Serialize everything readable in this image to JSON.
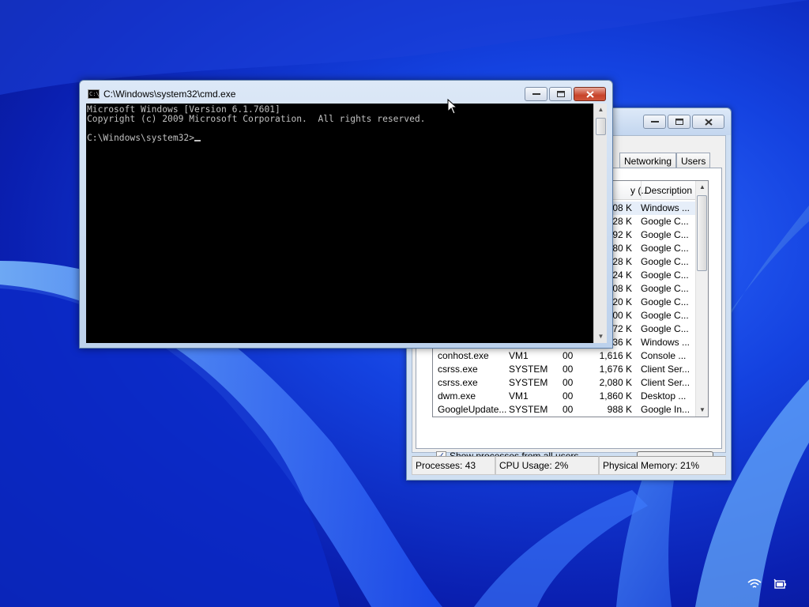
{
  "cmd": {
    "title": "C:\\Windows\\system32\\cmd.exe",
    "icon": "cmd-app-icon",
    "icon_text": "C:\\",
    "lines": [
      "Microsoft Windows [Version 6.1.7601]",
      "Copyright (c) 2009 Microsoft Corporation.  All rights reserved.",
      "",
      "C:\\Windows\\system32>"
    ]
  },
  "task_manager": {
    "tabs": [
      "Networking",
      "Users"
    ],
    "columns": {
      "memory": "y (...",
      "description": "Description"
    },
    "rows": [
      {
        "name": "",
        "user": "",
        "cpu": "",
        "memory": "08 K",
        "description": "Windows ..."
      },
      {
        "name": "",
        "user": "",
        "cpu": "",
        "memory": "28 K",
        "description": "Google C..."
      },
      {
        "name": "",
        "user": "",
        "cpu": "",
        "memory": "92 K",
        "description": "Google C..."
      },
      {
        "name": "",
        "user": "",
        "cpu": "",
        "memory": "80 K",
        "description": "Google C..."
      },
      {
        "name": "",
        "user": "",
        "cpu": "",
        "memory": "28 K",
        "description": "Google C..."
      },
      {
        "name": "",
        "user": "",
        "cpu": "",
        "memory": "24 K",
        "description": "Google C..."
      },
      {
        "name": "",
        "user": "",
        "cpu": "",
        "memory": "08 K",
        "description": "Google C..."
      },
      {
        "name": "",
        "user": "",
        "cpu": "",
        "memory": "20 K",
        "description": "Google C..."
      },
      {
        "name": "",
        "user": "",
        "cpu": "",
        "memory": "00 K",
        "description": "Google C..."
      },
      {
        "name": "",
        "user": "",
        "cpu": "",
        "memory": "72 K",
        "description": "Google C..."
      },
      {
        "name": "",
        "user": "",
        "cpu": "",
        "memory": "36 K",
        "description": "Windows ..."
      },
      {
        "name": "conhost.exe",
        "user": "VM1",
        "cpu": "00",
        "memory": "1,616 K",
        "description": "Console ..."
      },
      {
        "name": "csrss.exe",
        "user": "SYSTEM",
        "cpu": "00",
        "memory": "1,676 K",
        "description": "Client Ser..."
      },
      {
        "name": "csrss.exe",
        "user": "SYSTEM",
        "cpu": "00",
        "memory": "2,080 K",
        "description": "Client Ser..."
      },
      {
        "name": "dwm.exe",
        "user": "VM1",
        "cpu": "00",
        "memory": "1,860 K",
        "description": "Desktop ..."
      },
      {
        "name": "GoogleUpdate...",
        "user": "SYSTEM",
        "cpu": "00",
        "memory": "988 K",
        "description": "Google In..."
      }
    ],
    "show_all_label": "Show processes from all users",
    "show_all_checked": true,
    "end_process_label": "End Process",
    "status": {
      "processes": "Processes: 43",
      "cpu": "CPU Usage: 2%",
      "memory": "Physical Memory: 21%"
    }
  },
  "tray": {
    "icons": [
      "wifi-icon",
      "battery-icon"
    ]
  },
  "colors": {
    "console_bg": "#000000",
    "console_fg": "#c0c0c0",
    "desktop": "#1442e0"
  }
}
